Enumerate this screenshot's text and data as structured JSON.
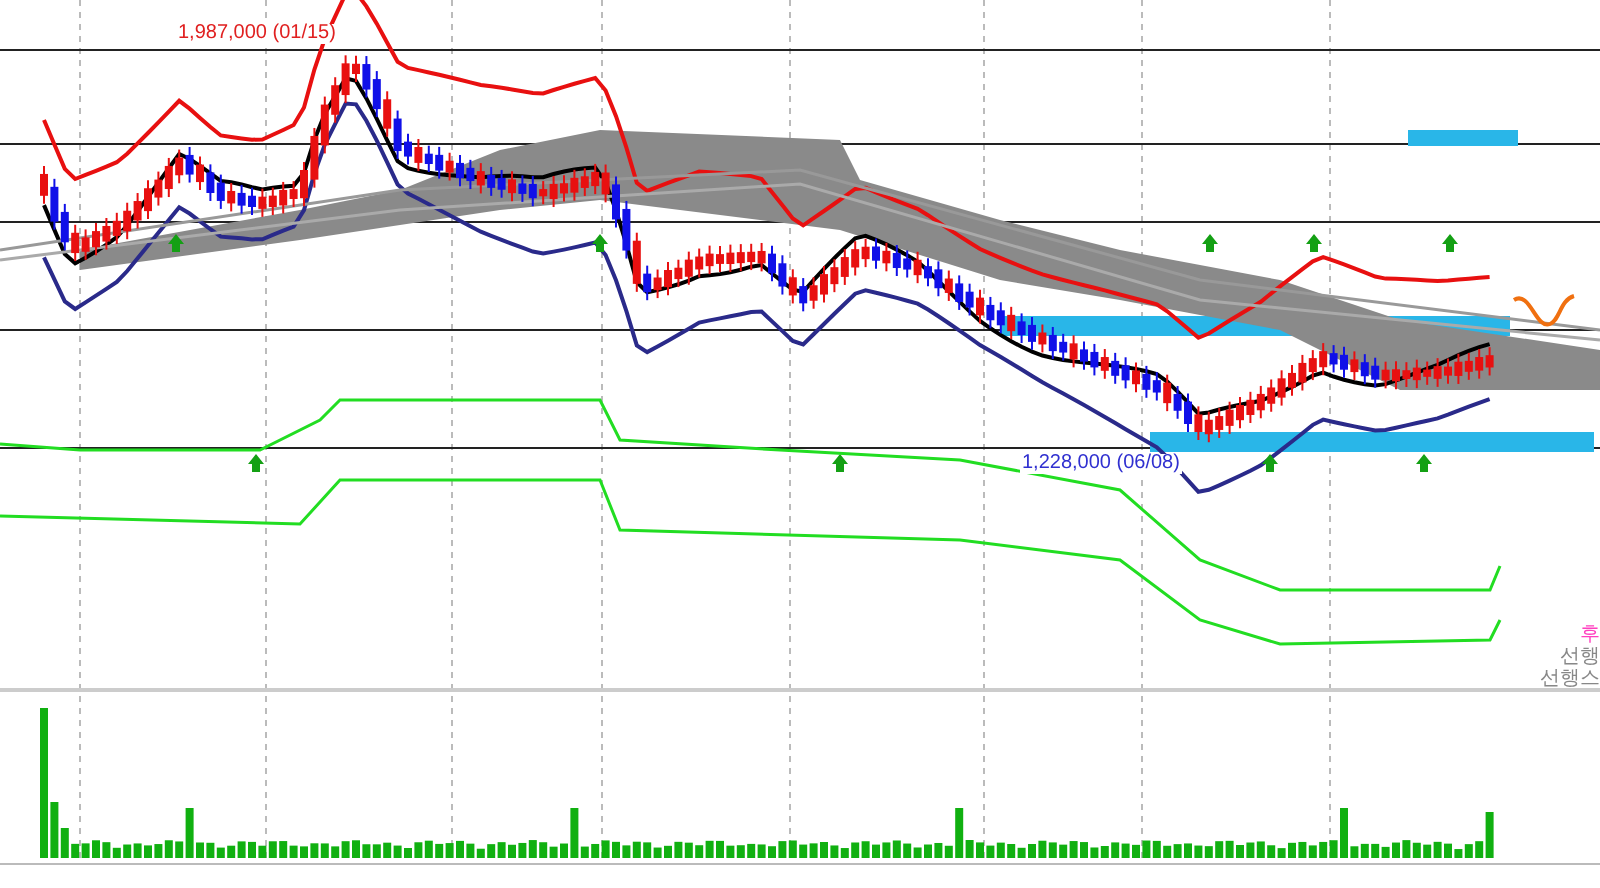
{
  "chart": {
    "high_label": "1,987,000 (01/15)",
    "low_label": "1,228,000 (06/08)"
  },
  "side_labels": [
    {
      "text": "후",
      "kind": "accent"
    },
    {
      "text": "선행",
      "kind": "plain"
    },
    {
      "text": "선행스",
      "kind": "plain"
    }
  ]
}
